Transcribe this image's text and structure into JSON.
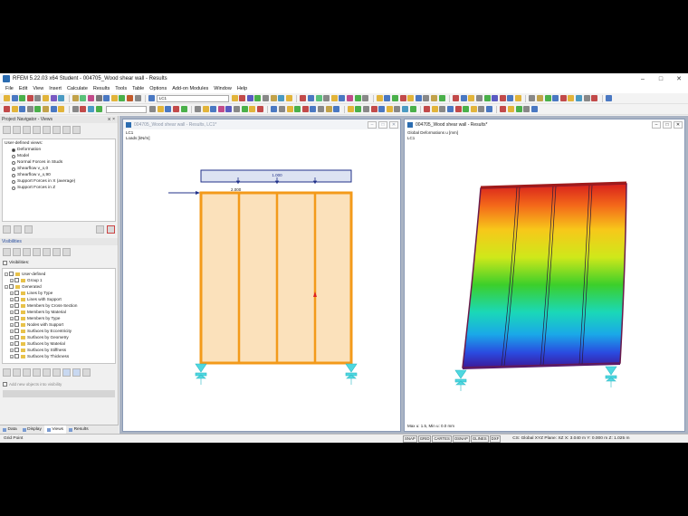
{
  "window": {
    "title": "RFEM 5.22.03 x64 Student - 004705_Wood shear wall - Results",
    "min": "–",
    "max": "□",
    "close": "✕"
  },
  "menu": [
    "File",
    "Edit",
    "View",
    "Insert",
    "Calculate",
    "Results",
    "Tools",
    "Table",
    "Options",
    "Add-on Modules",
    "Window",
    "Help"
  ],
  "toolbar": {
    "loadcase_value": "LC1",
    "colors_row1": [
      "#e2b43a",
      "#4a78c2",
      "#4ab04a",
      "#c24a4a",
      "#888",
      "#e2b43a",
      "#7a5ac2",
      "#4a9ac2",
      "#c2a24a",
      "#5ac27a",
      "#c24a8a",
      "#777",
      "#4a78c2",
      "#e2b43a",
      "#4ab04a",
      "#c25a2a",
      "#888",
      "#4a78c2",
      "#e2b43a",
      "#c24a4a",
      "#5a5ac2",
      "#4ab04a",
      "#888",
      "#c2a24a",
      "#4a9ac2",
      "#e2b43a",
      "#c24a4a",
      "#4a78c2",
      "#5ac27a",
      "#888",
      "#e2b43a",
      "#4a78c2",
      "#c24a8a",
      "#4ab04a",
      "#888",
      "#e2b43a",
      "#4a78c2",
      "#4ab04a",
      "#c24a4a",
      "#e2b43a",
      "#4a78c2",
      "#888",
      "#c2a24a",
      "#4ab04a",
      "#c24a4a",
      "#4a78c2",
      "#e2b43a",
      "#888",
      "#4ab04a",
      "#5a5ac2",
      "#c24a4a",
      "#4a78c2",
      "#e2b43a",
      "#888",
      "#c2a24a",
      "#4ab04a",
      "#4a78c2",
      "#c24a4a",
      "#e2b43a",
      "#4a9ac2",
      "#888",
      "#c24a4a",
      "#4a78c2"
    ],
    "colors_row2": [
      "#c24a4a",
      "#e2b43a",
      "#4a78c2",
      "#888",
      "#4ab04a",
      "#c2a24a",
      "#4a78c2",
      "#e2b43a",
      "#888",
      "#c24a4a",
      "#4a9ac2",
      "#4ab04a",
      "#888",
      "#e2b43a",
      "#4a78c2",
      "#c24a4a",
      "#4ab04a",
      "#888",
      "#e2b43a",
      "#4a78c2",
      "#c24a8a",
      "#5a5ac2",
      "#888",
      "#4ab04a",
      "#e2b43a",
      "#c24a4a",
      "#4a78c2",
      "#888",
      "#e2b43a",
      "#4ab04a",
      "#c24a4a",
      "#4a78c2",
      "#888",
      "#c2a24a",
      "#4a78c2",
      "#e2b43a",
      "#4ab04a",
      "#888",
      "#c24a4a",
      "#4a78c2",
      "#e2b43a",
      "#888",
      "#4a9ac2",
      "#4ab04a",
      "#c24a4a",
      "#e2b43a",
      "#888",
      "#4a78c2",
      "#c24a4a",
      "#4ab04a",
      "#e2b43a",
      "#888",
      "#4a78c2",
      "#c24a4a",
      "#e2b43a",
      "#4ab04a",
      "#888",
      "#4a78c2"
    ]
  },
  "navigator": {
    "title": "Project Navigator - Views",
    "pin": "⨯ ×",
    "views_header": "User-defined views:",
    "views": [
      "Deformation",
      "Model",
      "Normal Forces in Studs",
      "Shearflow v_x,0",
      "Shearflow v_x,90",
      "Support Forces in X (average)",
      "Support Forces in Z"
    ],
    "selected_view": 0,
    "visibilities_title": "Visibilities",
    "visibilities_checkbox": "Visibilities:",
    "tree": [
      {
        "label": "User-defined",
        "level": 0
      },
      {
        "label": "Group 1",
        "level": 1
      },
      {
        "label": "Generated",
        "level": 0
      },
      {
        "label": "Lines by Type",
        "level": 1
      },
      {
        "label": "Lines with Support",
        "level": 1
      },
      {
        "label": "Members by Cross-Section",
        "level": 1
      },
      {
        "label": "Members by Material",
        "level": 1
      },
      {
        "label": "Members by Type",
        "level": 1
      },
      {
        "label": "Nodes with Support",
        "level": 1
      },
      {
        "label": "Surfaces by Eccentricity",
        "level": 1
      },
      {
        "label": "Surfaces by Geometry",
        "level": 1
      },
      {
        "label": "Surfaces by Material",
        "level": 1
      },
      {
        "label": "Surfaces by Stiffness",
        "level": 1
      },
      {
        "label": "Surfaces by Thickness",
        "level": 1
      }
    ],
    "add_new": "Add new objects into visibility",
    "tabs": [
      "Data",
      "Display",
      "Views",
      "Results"
    ],
    "active_tab": 2
  },
  "window1": {
    "title": "004705_Wood shear wall - Results, LC1*",
    "line1": "LC1",
    "line2": "Loads [kN/m]",
    "load_top": "1.000",
    "load_side": "2.000"
  },
  "window2": {
    "title": "004705_Wood shear wall - Results*",
    "line1": "Global Deformations u [mm]",
    "line2": "LC1",
    "footer": "Max u: 1.5, Min u: 0.0 mm"
  },
  "statusbar": {
    "left": "Grid Point",
    "buttons": [
      "SNAP",
      "GRID",
      "CARTES",
      "OSNAP",
      "GLINES",
      "DXF"
    ],
    "right": "CS: Global XYZ   Plane: XZ          X: 3.040 m    Y: 0.000 m    Z: 1.025 m"
  }
}
